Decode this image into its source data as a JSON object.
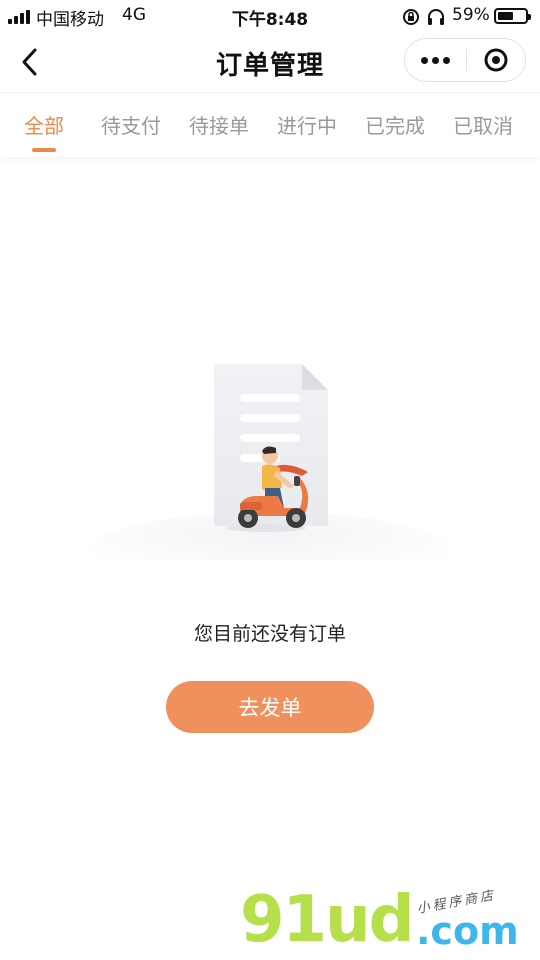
{
  "status_bar": {
    "carrier": "中国移动",
    "network": "4G",
    "time": "下午8:48",
    "battery_percent": "59%",
    "battery_level": 0.59
  },
  "nav": {
    "title": "订单管理"
  },
  "tabs": [
    {
      "label": "全部",
      "active": true
    },
    {
      "label": "待支付",
      "active": false
    },
    {
      "label": "待接单",
      "active": false
    },
    {
      "label": "进行中",
      "active": false
    },
    {
      "label": "已完成",
      "active": false
    },
    {
      "label": "已取消",
      "active": false
    }
  ],
  "empty_state": {
    "message": "您目前还没有订单",
    "button_label": "去发单"
  },
  "watermark": {
    "brand": "91ud",
    "domain_suffix": ".com",
    "tagline": "小程序商店"
  },
  "colors": {
    "accent": "#e8894f",
    "button": "#f0905c",
    "tab_inactive": "#999999"
  }
}
